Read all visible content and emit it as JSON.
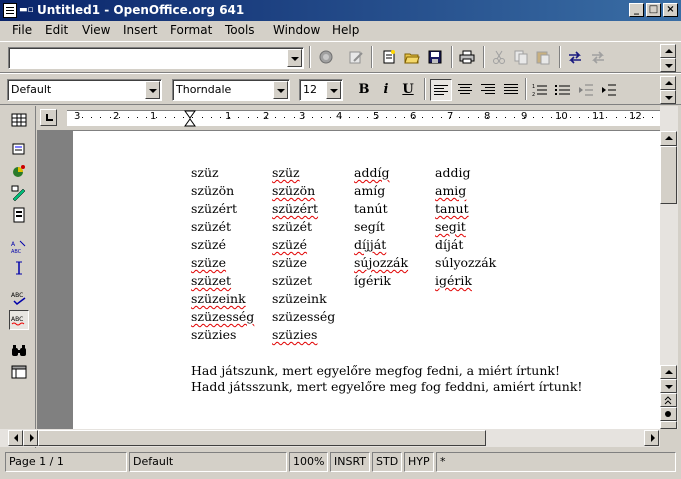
{
  "window": {
    "title": "Untitled1 - OpenOffice.org 641",
    "system_menu_glyph": "▬▫",
    "minimize_glyph": "_",
    "maximize_glyph": "□",
    "close_glyph": "×"
  },
  "menu": {
    "items": [
      "File",
      "Edit",
      "View",
      "Insert",
      "Format",
      "Tools",
      "Window",
      "Help"
    ]
  },
  "toolbar1": {
    "url_value": "",
    "icons": [
      "stop-icon",
      "edit-file-icon",
      "new-document-icon",
      "open-icon",
      "save-icon",
      "print-icon",
      "cut-icon",
      "copy-icon",
      "paste-icon",
      "undo-icon",
      "redo-icon"
    ]
  },
  "toolbar2": {
    "style_value": "Default",
    "font_value": "Thorndale",
    "size_value": "12",
    "bold_label": "B",
    "italic_label": "i",
    "underline_label": "U"
  },
  "ruler": {
    "labels": [
      "3",
      "2",
      "1",
      "1",
      "2",
      "3",
      "4",
      "5",
      "6",
      "7",
      "8",
      "9",
      "10",
      "11",
      "12"
    ]
  },
  "document": {
    "columns": [
      [
        {
          "text": "szüz",
          "misspelled": false
        },
        {
          "text": "szüzön",
          "misspelled": false
        },
        {
          "text": "szüzért",
          "misspelled": false
        },
        {
          "text": "szüzét",
          "misspelled": false
        },
        {
          "text": "szüzé",
          "misspelled": false
        },
        {
          "text": "szüze",
          "misspelled": true
        },
        {
          "text": "szüzet",
          "misspelled": true
        },
        {
          "text": "szüzeink",
          "misspelled": true
        },
        {
          "text": "szüzesség",
          "misspelled": true
        },
        {
          "text": "szüzies",
          "misspelled": false
        }
      ],
      [
        {
          "text": "szüz",
          "misspelled": true
        },
        {
          "text": "szüzön",
          "misspelled": true
        },
        {
          "text": "szüzért",
          "misspelled": true
        },
        {
          "text": "szüzét",
          "misspelled": false
        },
        {
          "text": "szüzé",
          "misspelled": true
        },
        {
          "text": "szüze",
          "misspelled": false
        },
        {
          "text": "szüzet",
          "misspelled": false
        },
        {
          "text": "szüzeink",
          "misspelled": false
        },
        {
          "text": "szüzesség",
          "misspelled": false
        },
        {
          "text": "szüzies",
          "misspelled": true
        }
      ],
      [
        {
          "text": "addíg",
          "misspelled": true
        },
        {
          "text": "amíg",
          "misspelled": false
        },
        {
          "text": "tanút",
          "misspelled": false
        },
        {
          "text": "segít",
          "misspelled": false
        },
        {
          "text": "díjját",
          "misspelled": true
        },
        {
          "text": "sújozzák",
          "misspelled": true
        },
        {
          "text": "ígérik",
          "misspelled": false
        }
      ],
      [
        {
          "text": "addig",
          "misspelled": false
        },
        {
          "text": "amig",
          "misspelled": true
        },
        {
          "text": "tanut",
          "misspelled": true
        },
        {
          "text": "segit",
          "misspelled": true
        },
        {
          "text": "díját",
          "misspelled": false
        },
        {
          "text": "súlyozzák",
          "misspelled": false
        },
        {
          "text": "igérik",
          "misspelled": true
        }
      ]
    ],
    "sentence1": "Had játszunk, mert egyelőre megfog fedni, a miért írtunk!",
    "sentence2": "Hadd játsszunk, mert egyelőre meg fog feddni, amiért írtunk!"
  },
  "status": {
    "page": "Page 1 / 1",
    "style": "Default",
    "zoom": "100%",
    "insert_mode": "INSRT",
    "selection_mode": "STD",
    "hyperlink_mode": "HYP",
    "modified": "*"
  }
}
